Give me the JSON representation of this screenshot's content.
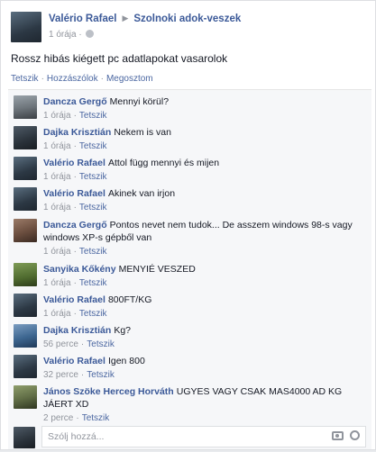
{
  "post": {
    "author": "Valério Rafael",
    "group": "Szolnoki adok-veszek",
    "time": "1 órája",
    "separator": "·",
    "text": "Rossz hibás kiégett pc adatlapokat vasarolok",
    "actions": {
      "like": "Tetszik",
      "comment": "Hozzászólok",
      "share": "Megosztom",
      "sep": "·"
    }
  },
  "comments": [
    {
      "author": "Dancza Gergő",
      "text": "Mennyi körül?",
      "time": "1 órája",
      "like": "Tetszik"
    },
    {
      "author": "Dajka Krisztián",
      "text": "Nekem is van",
      "time": "1 órája",
      "like": "Tetszik"
    },
    {
      "author": "Valério Rafael",
      "text": "Attol függ mennyi és mijen",
      "time": "1 órája",
      "like": "Tetszik"
    },
    {
      "author": "Valério Rafael",
      "text": "Akinek van irjon",
      "time": "1 órája",
      "like": "Tetszik"
    },
    {
      "author": "Dancza Gergő",
      "text": "Pontos nevet nem tudok... De asszem windows 98-s vagy windows XP-s gépből van",
      "time": "1 órája",
      "like": "Tetszik"
    },
    {
      "author": "Sanyika Kőkény",
      "text": "MENYIÉ VESZED",
      "time": "1 órája",
      "like": "Tetszik"
    },
    {
      "author": "Valério Rafael",
      "text": "800FT/KG",
      "time": "1 órája",
      "like": "Tetszik"
    },
    {
      "author": "Dajka Krisztián",
      "text": "Kg?",
      "time": "56 perce",
      "like": "Tetszik"
    },
    {
      "author": "Valério Rafael",
      "text": "Igen 800",
      "time": "32 perce",
      "like": "Tetszik"
    },
    {
      "author": "János Szöke Herceg Horváth",
      "text": "UGYES VAGY CSAK MAS4000 AD KG JÁERT XD",
      "time": "2 perce",
      "like": "Tetszik"
    }
  ],
  "composer": {
    "placeholder": "Szólj hozzá..."
  },
  "icons": {
    "arrow": "▶",
    "globe": "globe-icon",
    "camera": "camera-icon",
    "emoji": "emoji-icon"
  }
}
